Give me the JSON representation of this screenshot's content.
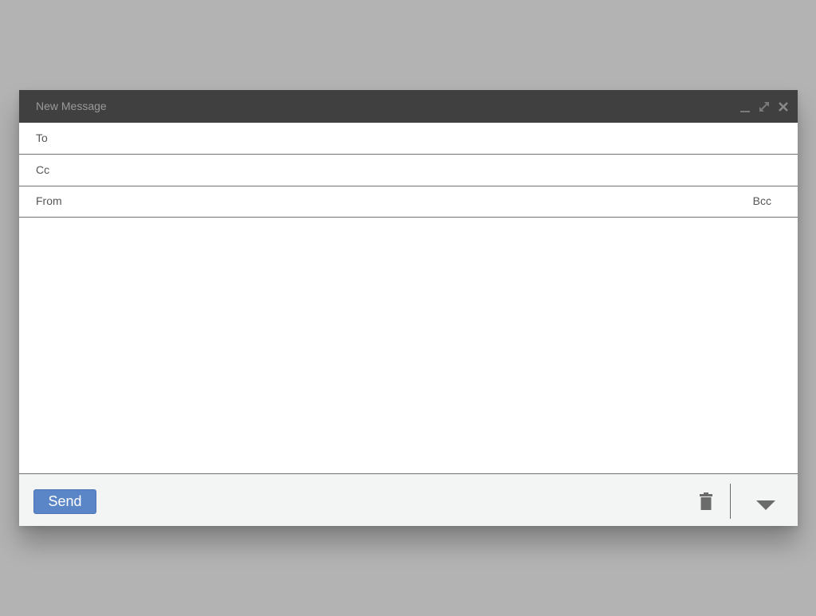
{
  "window": {
    "title": "New Message",
    "controls": {
      "minimize_icon": "minimize-icon",
      "expand_icon": "expand-icon",
      "close_icon": "close-icon"
    }
  },
  "fields": {
    "to": {
      "label": "To",
      "value": ""
    },
    "cc": {
      "label": "Cc",
      "value": ""
    },
    "from": {
      "label": "From",
      "value": "",
      "bcc_label": "Bcc"
    }
  },
  "body": {
    "value": ""
  },
  "footer": {
    "send_label": "Send",
    "delete_icon": "trash-icon",
    "more_icon": "caret-down-icon"
  },
  "colors": {
    "background": "#b3b3b3",
    "titlebar": "#404040",
    "send_button": "#5a86c8",
    "footer": "#f3f4f4"
  }
}
